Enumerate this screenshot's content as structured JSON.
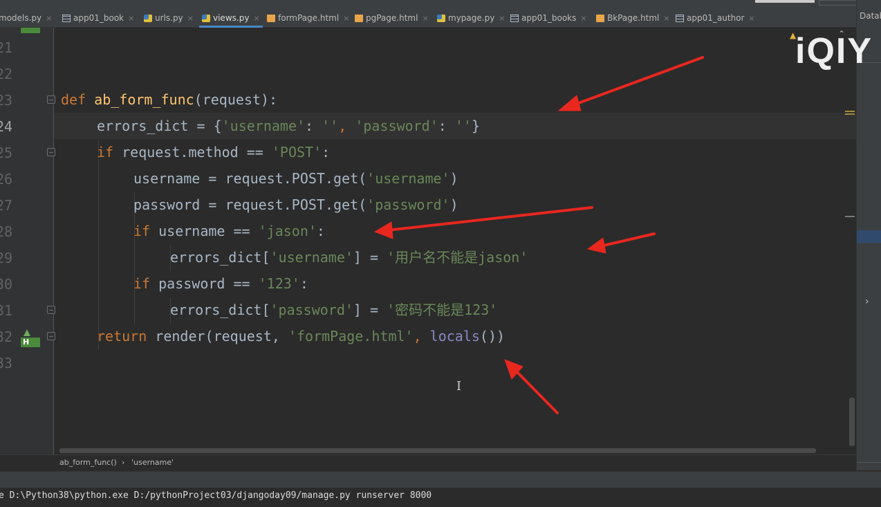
{
  "tabs": [
    {
      "label": "models.py",
      "icon": "python-file-icon"
    },
    {
      "label": "app01_book",
      "icon": "table-icon"
    },
    {
      "label": "urls.py",
      "icon": "python-file-icon"
    },
    {
      "label": "views.py",
      "icon": "python-file-icon",
      "active": true
    },
    {
      "label": "formPage.html",
      "icon": "html-file-icon"
    },
    {
      "label": "pgPage.html",
      "icon": "html-file-icon"
    },
    {
      "label": "mypage.py",
      "icon": "python-file-icon"
    },
    {
      "label": "app01_books",
      "icon": "table-icon"
    },
    {
      "label": "BkPage.html",
      "icon": "html-file-icon"
    },
    {
      "label": "app01_author",
      "icon": "table-icon"
    }
  ],
  "tab_close_glyph": "×",
  "right_panel_label": "Datab",
  "watermark": "iQIY",
  "line_numbers": [
    "21",
    "22",
    "23",
    "24",
    "25",
    "26",
    "27",
    "28",
    "29",
    "30",
    "31",
    "32",
    "33"
  ],
  "current_line": "24",
  "code": {
    "l23": {
      "kw": "def ",
      "fn": "ab_form_func",
      "rest": "(request):"
    },
    "l24": {
      "a": "errors_dict = {",
      "s1": "'username'",
      "b": ": ",
      "s2": "''",
      "c": ", ",
      "s3": "'password'",
      "d": ": ",
      "s4": "''",
      "e": "}"
    },
    "l25": {
      "kw": "if ",
      "a": "request.method == ",
      "s": "'POST'",
      "b": ":"
    },
    "l26": {
      "a": "username = request.POST.get(",
      "s": "'username'",
      "b": ")"
    },
    "l27": {
      "a": "password = request.POST.get(",
      "s": "'password'",
      "b": ")"
    },
    "l28": {
      "kw": "if ",
      "a": "username == ",
      "s": "'jason'",
      "b": ":"
    },
    "l29": {
      "a": "errors_dict[",
      "s1": "'username'",
      "b": "] = ",
      "s2": "'用户名不能是jason'"
    },
    "l30": {
      "kw": "if ",
      "a": "password == ",
      "s": "'123'",
      "b": ":"
    },
    "l31": {
      "a": "errors_dict[",
      "s1": "'password'",
      "b": "] = ",
      "s2": "'密码不能是123'"
    },
    "l32": {
      "kw": "return ",
      "a": "render(request, ",
      "s": "'formPage.html'",
      "b": ", ",
      "bi": "locals",
      "c": "())"
    }
  },
  "breadcrumb": {
    "function": "ab_form_func()",
    "separator": "›",
    "key": "'username'"
  },
  "run_console": "e D:\\Python38\\python.exe D:/pythonProject03/djangoday09/manage.py runserver 8000",
  "badge_letter": "H",
  "colors": {
    "keyword": "#cc7832",
    "function": "#ffc66d",
    "string": "#6a8759",
    "builtin": "#8888c6",
    "annotation_arrow": "#e8271f"
  }
}
